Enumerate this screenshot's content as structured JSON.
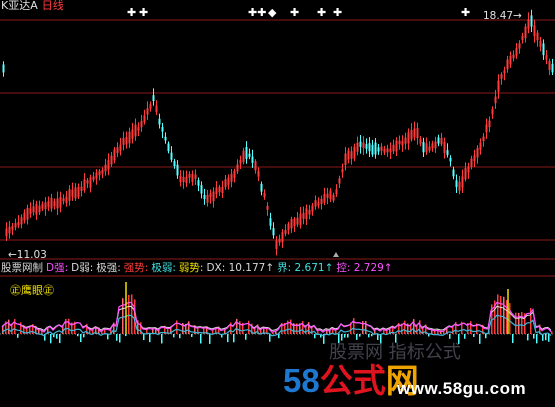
{
  "header": {
    "stock_name": "K亚达A",
    "period": "日线"
  },
  "price_labels": {
    "low": "←11.03",
    "high": "18.47→"
  },
  "indicator_bar": [
    {
      "text": "股票网制",
      "color": "#d8d8d8"
    },
    {
      "text": "D强:",
      "color": "#ff50ff"
    },
    {
      "text": "D弱:",
      "color": "#d8d8d8"
    },
    {
      "text": "极强:",
      "color": "#d8d8d8"
    },
    {
      "text": "强势:",
      "color": "#ff3b3b"
    },
    {
      "text": "极弱:",
      "color": "#40e0e0"
    },
    {
      "text": "弱势:",
      "color": "#f0e000"
    },
    {
      "text": "DX: 10.177↑",
      "color": "#d8d8d8"
    },
    {
      "text": "界: 2.671↑",
      "color": "#40e0e0"
    },
    {
      "text": "控: 2.729↑",
      "color": "#ff50ff"
    }
  ],
  "sub_chart_label": "㊣鹰眼㊣",
  "watermark": {
    "logo_num": "58",
    "logo_gs": "公式",
    "logo_w": "网",
    "ghost": "股票网 指标公式",
    "site": "www.58gu.com"
  },
  "colors": {
    "up": "#ff3b3b",
    "down": "#54ffff",
    "grid": "#8b1a1a",
    "background": "#000000"
  },
  "chart_data": {
    "type": "candlestick",
    "price_low": 11.03,
    "price_high": 18.47,
    "signal_markers": [
      "✚",
      "✚",
      "✚✚",
      "◆",
      "✚",
      "✚",
      "✚",
      "✚"
    ]
  }
}
